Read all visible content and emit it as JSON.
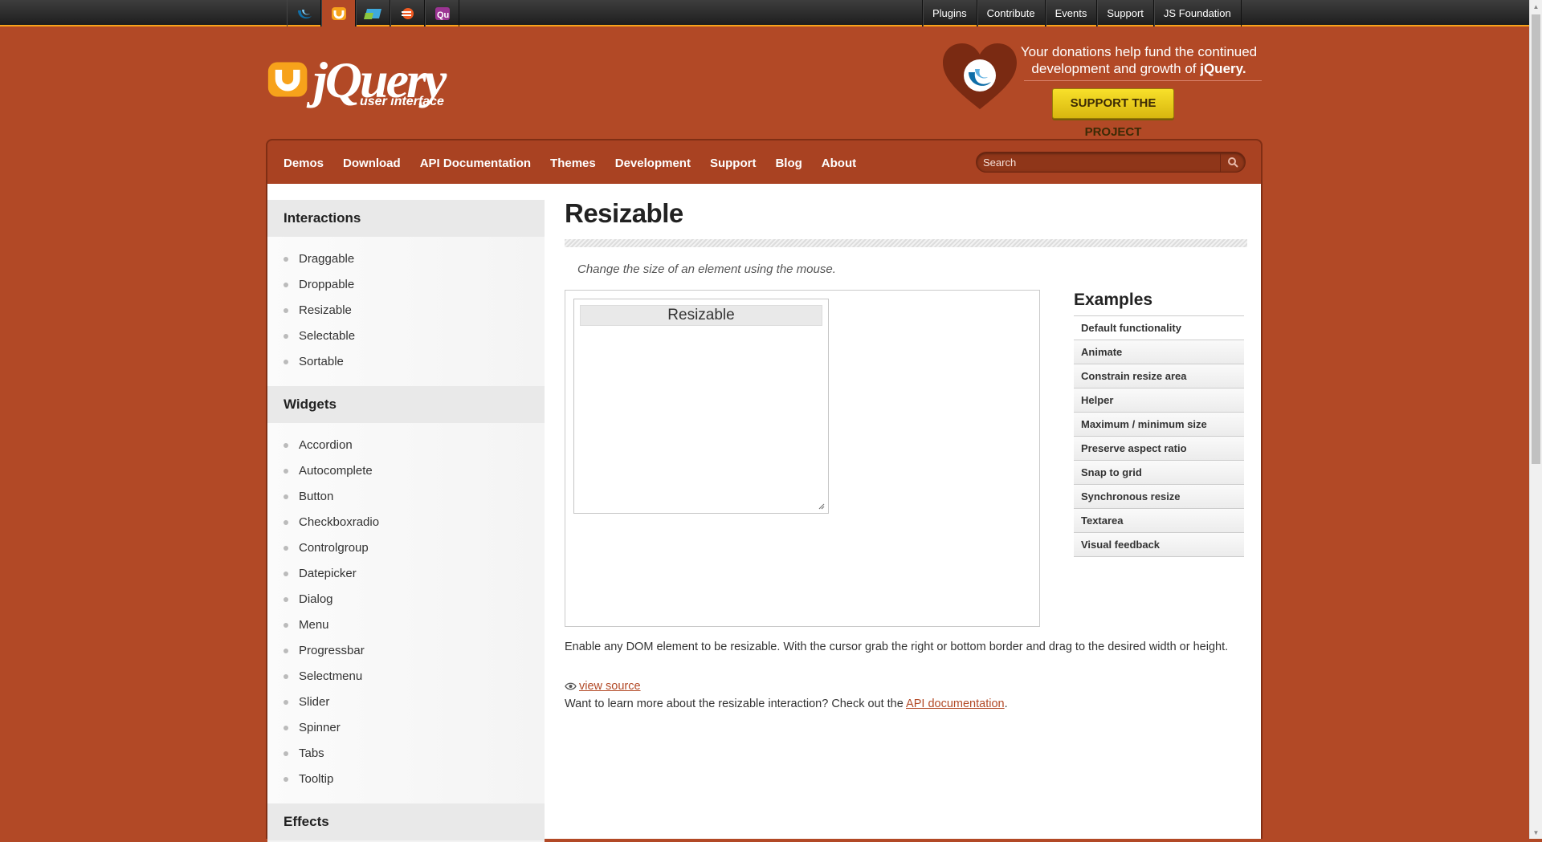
{
  "top_nav": {
    "links": [
      "Plugins",
      "Contribute",
      "Events",
      "Support",
      "JS Foundation"
    ]
  },
  "sites": [
    {
      "icon": "jquery-icon"
    },
    {
      "icon": "jqueryui-icon",
      "active": true
    },
    {
      "icon": "jquerymobile-icon"
    },
    {
      "icon": "sizzle-icon"
    },
    {
      "icon": "qunit-icon"
    }
  ],
  "logo": {
    "text": "jQuery",
    "sub": "user interface"
  },
  "donate": {
    "text_line1": "Your donations help fund the continued",
    "text_line2_prefix": "development and growth of ",
    "text_line2_bold": "jQuery.",
    "button": "SUPPORT THE PROJECT"
  },
  "nav": {
    "items": [
      "Demos",
      "Download",
      "API Documentation",
      "Themes",
      "Development",
      "Support",
      "Blog",
      "About"
    ],
    "search_placeholder": "Search"
  },
  "sidebar": {
    "sections": [
      {
        "title": "Interactions",
        "items": [
          "Draggable",
          "Droppable",
          "Resizable",
          "Selectable",
          "Sortable"
        ]
      },
      {
        "title": "Widgets",
        "items": [
          "Accordion",
          "Autocomplete",
          "Button",
          "Checkboxradio",
          "Controlgroup",
          "Datepicker",
          "Dialog",
          "Menu",
          "Progressbar",
          "Selectmenu",
          "Slider",
          "Spinner",
          "Tabs",
          "Tooltip"
        ]
      },
      {
        "title": "Effects",
        "items": []
      }
    ]
  },
  "main": {
    "title": "Resizable",
    "description": "Change the size of an element using the mouse.",
    "demo_header": "Resizable",
    "body": "Enable any DOM element to be resizable. With the cursor grab the right or bottom border and drag to the desired width or height.",
    "view_source": "view source",
    "learn_prefix": "Want to learn more about the resizable interaction? Check out the ",
    "learn_link": "API documentation",
    "learn_suffix": "."
  },
  "examples": {
    "title": "Examples",
    "items": [
      "Default functionality",
      "Animate",
      "Constrain resize area",
      "Helper",
      "Maximum / minimum size",
      "Preserve aspect ratio",
      "Snap to grid",
      "Synchronous resize",
      "Textarea",
      "Visual feedback"
    ]
  },
  "colors": {
    "brand": "#b24926",
    "accent": "#f7a21b",
    "button": "#f8e02a"
  }
}
